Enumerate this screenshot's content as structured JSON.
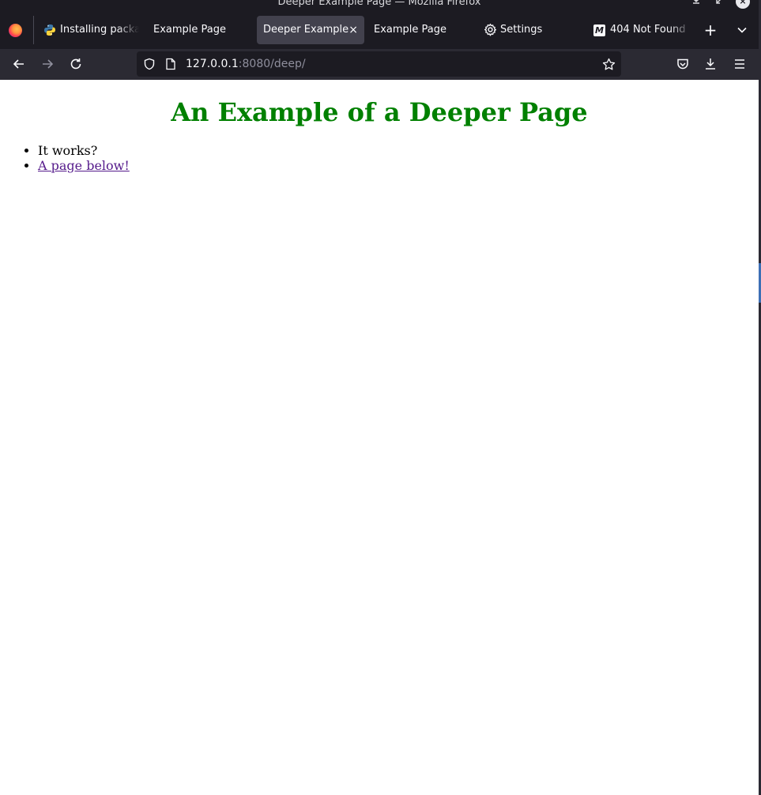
{
  "window": {
    "title": "Deeper Example Page — Mozilla Firefox"
  },
  "tabs": [
    {
      "label": "Installing packa",
      "icon": "python-icon",
      "active": false
    },
    {
      "label": "Example Page",
      "icon": null,
      "active": false
    },
    {
      "label": "Deeper Example",
      "icon": null,
      "active": true
    },
    {
      "label": "Example Page",
      "icon": null,
      "active": false
    },
    {
      "label": "Settings",
      "icon": "gear-icon",
      "active": false
    },
    {
      "label": "404 Not Found",
      "icon": "m-icon",
      "active": false
    }
  ],
  "icons": {
    "new_tab": "+",
    "list_tabs": "chevron-down-icon",
    "close_tab": "×",
    "m_glyph": "M"
  },
  "urlbar": {
    "host": "127.0.0.1",
    "rest": ":8080/deep/"
  },
  "page": {
    "heading": "An Example of a Deeper Page",
    "items": [
      {
        "text": "It works?",
        "link": false
      },
      {
        "text": "A page below!",
        "link": true
      }
    ]
  },
  "colors": {
    "heading": "#008000",
    "visited_link": "#551a8b",
    "chrome_dark": "#1c1b22",
    "active_tab": "#42414d"
  }
}
